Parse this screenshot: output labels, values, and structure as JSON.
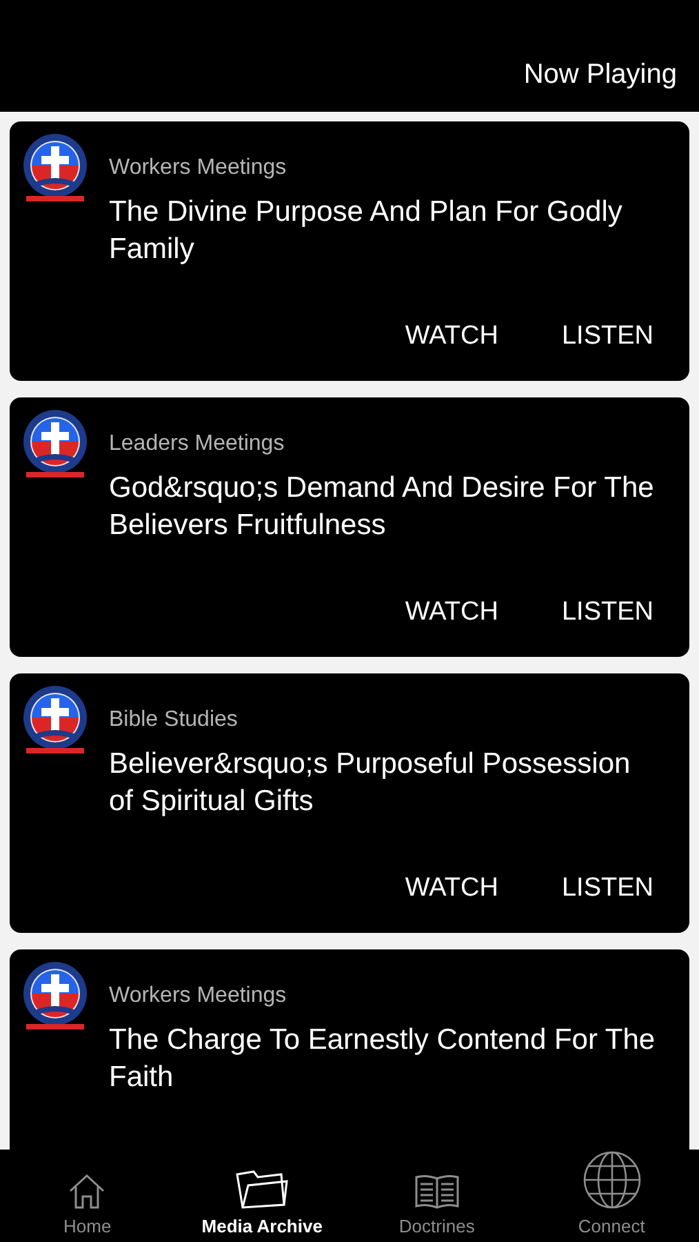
{
  "header": {
    "now_playing": "Now Playing"
  },
  "items": [
    {
      "category": "Workers Meetings",
      "title": "The Divine Purpose And Plan For Godly Family",
      "actions": [
        "WATCH",
        "LISTEN"
      ]
    },
    {
      "category": "Leaders Meetings",
      "title": "God&rsquo;s Demand And Desire For The Believers Fruitfulness",
      "actions": [
        "WATCH",
        "LISTEN"
      ]
    },
    {
      "category": "Bible Studies",
      "title": "Believer&rsquo;s Purposeful Possession of Spiritual Gifts",
      "actions": [
        "WATCH",
        "LISTEN"
      ]
    },
    {
      "category": "Workers Meetings",
      "title": "The Charge To Earnestly Contend For The Faith"
    }
  ],
  "tabs": [
    {
      "kind": "home",
      "label": "Home",
      "selected": false
    },
    {
      "kind": "folder",
      "label": "Media Archive",
      "selected": true
    },
    {
      "kind": "book",
      "label": "Doctrines",
      "selected": false
    },
    {
      "kind": "globe",
      "label": "Connect",
      "selected": false
    }
  ]
}
